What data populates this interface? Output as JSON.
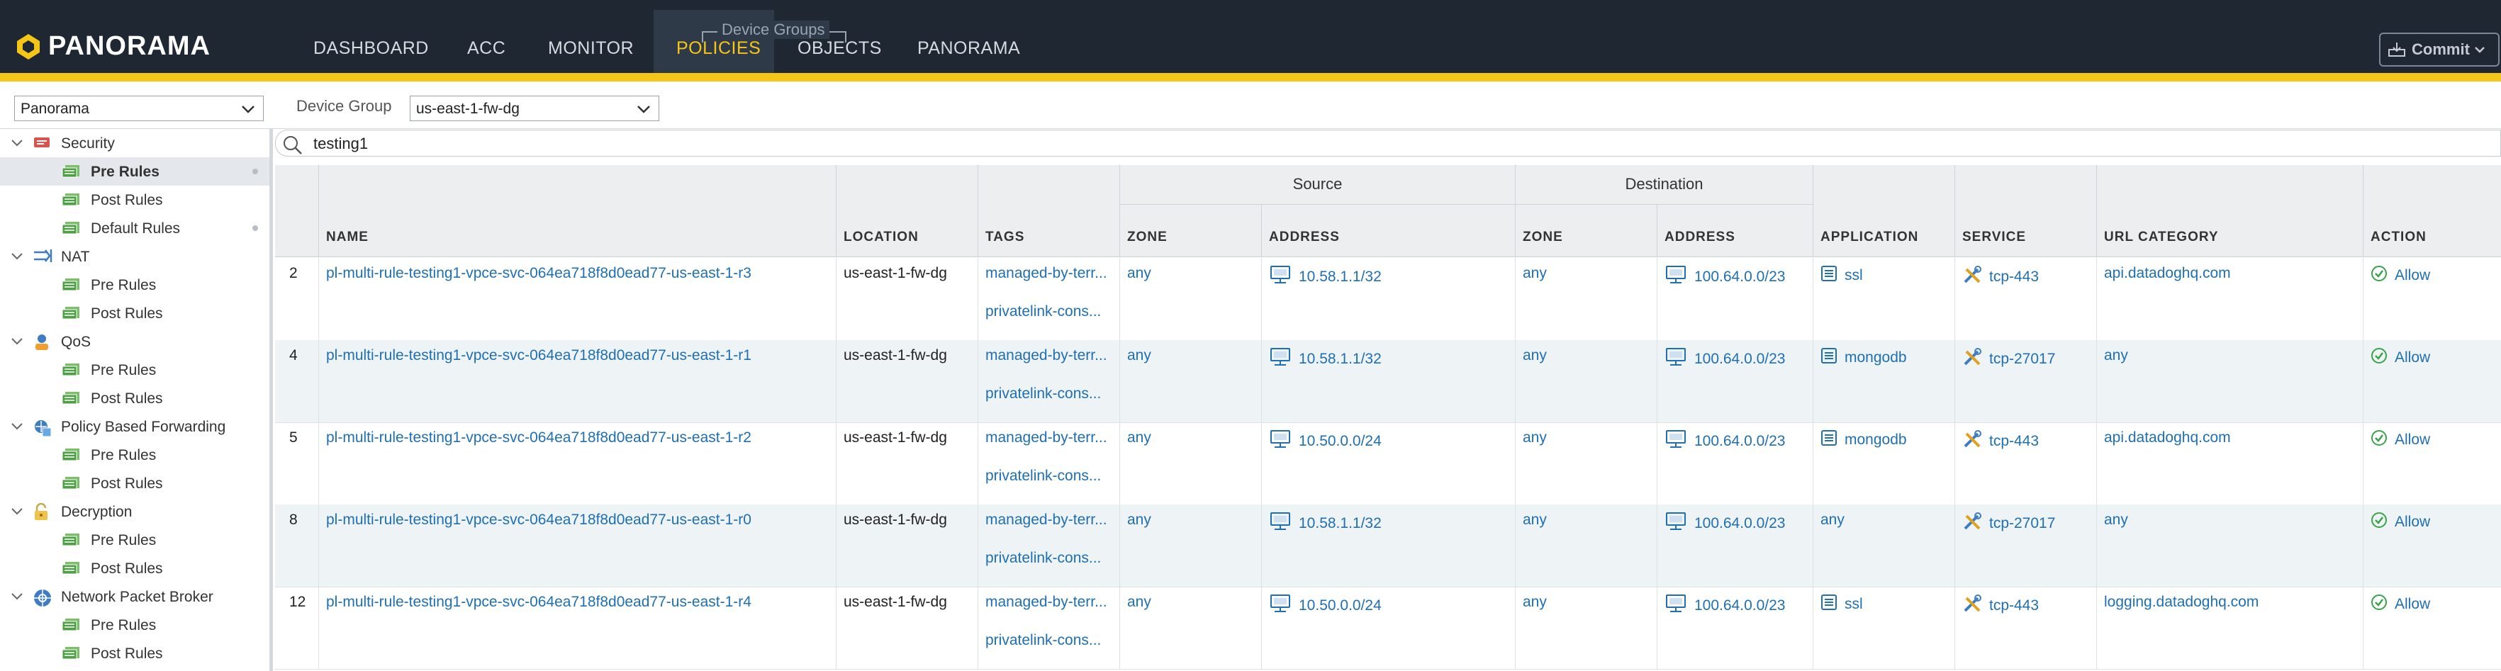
{
  "app": {
    "logo_text": "PANORAMA",
    "nav_tabs": [
      "DASHBOARD",
      "ACC",
      "MONITOR",
      "POLICIES",
      "OBJECTS",
      "PANORAMA"
    ],
    "active_tab": "POLICIES",
    "device_groups_label": "Device Groups",
    "commit_label": "Commit"
  },
  "filters": {
    "context_value": "Panorama",
    "device_group_label": "Device Group",
    "device_group_value": "us-east-1-fw-dg"
  },
  "sidebar": {
    "items": [
      {
        "label": "Security",
        "icon": "security-icon",
        "level": 0
      },
      {
        "label": "Pre Rules",
        "icon": "rules-icon",
        "level": 1,
        "selected": true
      },
      {
        "label": "Post Rules",
        "icon": "rules-icon",
        "level": 1
      },
      {
        "label": "Default Rules",
        "icon": "rules-icon",
        "level": 1
      },
      {
        "label": "NAT",
        "icon": "nat-icon",
        "level": 0
      },
      {
        "label": "Pre Rules",
        "icon": "rules-icon",
        "level": 1
      },
      {
        "label": "Post Rules",
        "icon": "rules-icon",
        "level": 1
      },
      {
        "label": "QoS",
        "icon": "qos-icon",
        "level": 0
      },
      {
        "label": "Pre Rules",
        "icon": "rules-icon",
        "level": 1
      },
      {
        "label": "Post Rules",
        "icon": "rules-icon",
        "level": 1
      },
      {
        "label": "Policy Based Forwarding",
        "icon": "pbf-icon",
        "level": 0
      },
      {
        "label": "Pre Rules",
        "icon": "rules-icon",
        "level": 1
      },
      {
        "label": "Post Rules",
        "icon": "rules-icon",
        "level": 1
      },
      {
        "label": "Decryption",
        "icon": "decryption-icon",
        "level": 0
      },
      {
        "label": "Pre Rules",
        "icon": "rules-icon",
        "level": 1
      },
      {
        "label": "Post Rules",
        "icon": "rules-icon",
        "level": 1
      },
      {
        "label": "Network Packet Broker",
        "icon": "npb-icon",
        "level": 0
      },
      {
        "label": "Pre Rules",
        "icon": "rules-icon",
        "level": 1
      },
      {
        "label": "Post Rules",
        "icon": "rules-icon",
        "level": 1
      }
    ]
  },
  "search": {
    "value": "testing1"
  },
  "table": {
    "group_headers": {
      "source": "Source",
      "destination": "Destination"
    },
    "columns": {
      "name": "NAME",
      "location": "LOCATION",
      "tags": "TAGS",
      "src_zone": "ZONE",
      "src_address": "ADDRESS",
      "dst_zone": "ZONE",
      "dst_address": "ADDRESS",
      "application": "APPLICATION",
      "service": "SERVICE",
      "url_category": "URL CATEGORY",
      "action": "ACTION"
    },
    "rows": [
      {
        "num": "2",
        "name": "pl-multi-rule-testing1-vpce-svc-064ea718f8d0ead77-us-east-1-r3",
        "location": "us-east-1-fw-dg",
        "tag1": "managed-by-terr...",
        "tag2": "privatelink-cons...",
        "src_zone": "any",
        "src_address": "10.58.1.1/32",
        "dst_zone": "any",
        "dst_address": "100.64.0.0/23",
        "application": "ssl",
        "app_icon": true,
        "service": "tcp-443",
        "url_category": "api.datadoghq.com",
        "action": "Allow"
      },
      {
        "num": "4",
        "name": "pl-multi-rule-testing1-vpce-svc-064ea718f8d0ead77-us-east-1-r1",
        "location": "us-east-1-fw-dg",
        "tag1": "managed-by-terr...",
        "tag2": "privatelink-cons...",
        "src_zone": "any",
        "src_address": "10.58.1.1/32",
        "dst_zone": "any",
        "dst_address": "100.64.0.0/23",
        "application": "mongodb",
        "app_icon": true,
        "service": "tcp-27017",
        "url_category": "any",
        "action": "Allow"
      },
      {
        "num": "5",
        "name": "pl-multi-rule-testing1-vpce-svc-064ea718f8d0ead77-us-east-1-r2",
        "location": "us-east-1-fw-dg",
        "tag1": "managed-by-terr...",
        "tag2": "privatelink-cons...",
        "src_zone": "any",
        "src_address": "10.50.0.0/24",
        "dst_zone": "any",
        "dst_address": "100.64.0.0/23",
        "application": "mongodb",
        "app_icon": true,
        "service": "tcp-443",
        "url_category": "api.datadoghq.com",
        "action": "Allow"
      },
      {
        "num": "8",
        "name": "pl-multi-rule-testing1-vpce-svc-064ea718f8d0ead77-us-east-1-r0",
        "location": "us-east-1-fw-dg",
        "tag1": "managed-by-terr...",
        "tag2": "privatelink-cons...",
        "src_zone": "any",
        "src_address": "10.58.1.1/32",
        "dst_zone": "any",
        "dst_address": "100.64.0.0/23",
        "application": "any",
        "app_icon": false,
        "service": "tcp-27017",
        "url_category": "any",
        "action": "Allow"
      },
      {
        "num": "12",
        "name": "pl-multi-rule-testing1-vpce-svc-064ea718f8d0ead77-us-east-1-r4",
        "location": "us-east-1-fw-dg",
        "tag1": "managed-by-terr...",
        "tag2": "privatelink-cons...",
        "src_zone": "any",
        "src_address": "10.50.0.0/24",
        "dst_zone": "any",
        "dst_address": "100.64.0.0/23",
        "application": "ssl",
        "app_icon": true,
        "service": "tcp-443",
        "url_category": "logging.datadoghq.com",
        "action": "Allow"
      }
    ]
  },
  "colors": {
    "nav_bg": "#1f2733",
    "accent": "#f5c518",
    "link": "#1f6fb2",
    "allow": "#3aa34a"
  }
}
